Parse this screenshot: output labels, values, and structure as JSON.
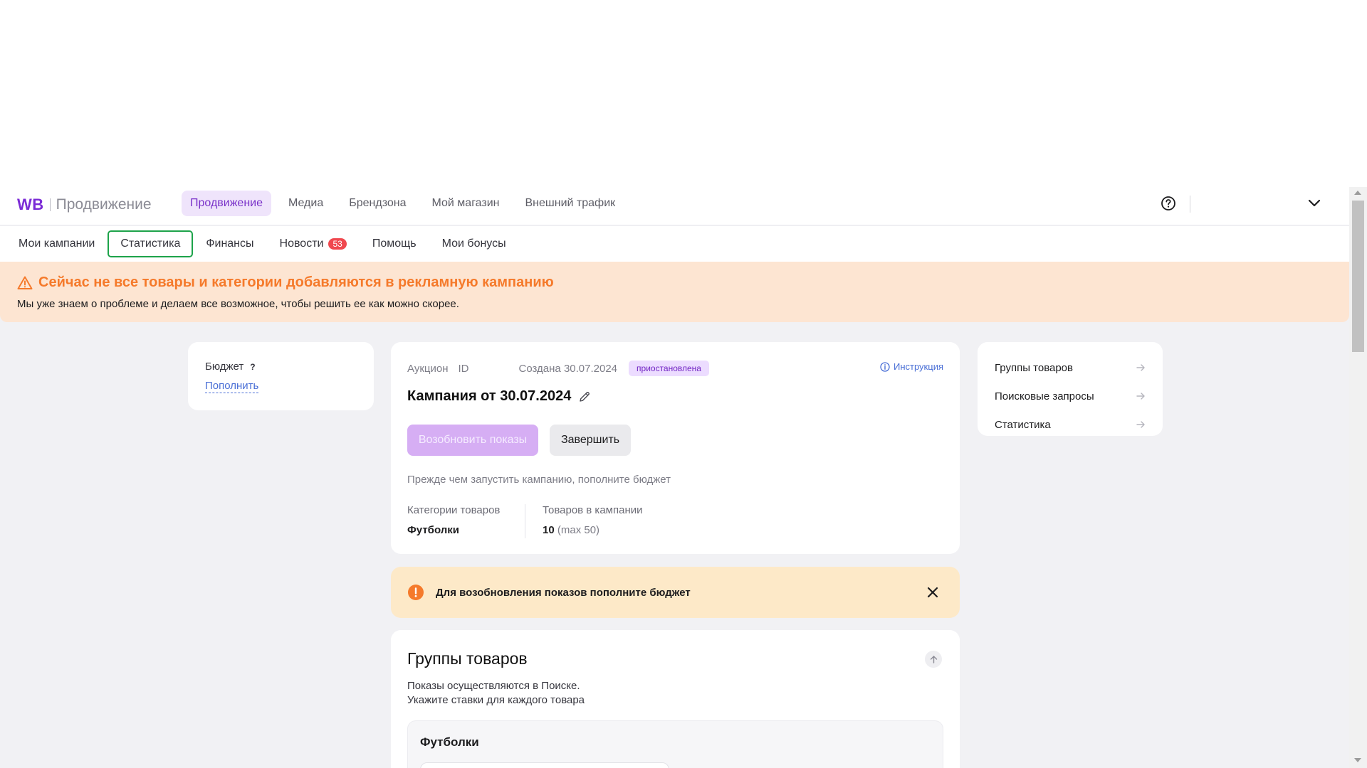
{
  "header": {
    "logo_brand": "WB",
    "logo_title": "Продвижение",
    "main_nav": [
      "Продвижение",
      "Медиа",
      "Брендзона",
      "Мой магазин",
      "Внешний трафик"
    ],
    "active_main_nav": "Продвижение"
  },
  "sub_nav": {
    "items": [
      "Мои кампании",
      "Статистика",
      "Финансы",
      "Новости",
      "Помощь",
      "Мои бонусы"
    ],
    "focused_item": "Статистика",
    "news_badge": "53"
  },
  "warning": {
    "title": "Сейчас не все товары и категории добавляются в рекламную кампанию",
    "text": "Мы уже знаем о проблеме и делаем все возможное, чтобы решить ее как можно скорее."
  },
  "budget": {
    "label": "Бюджет",
    "help": "?",
    "topup_link": "Пополнить"
  },
  "campaign": {
    "type": "Аукцион",
    "id_label": "ID",
    "created": "Создана 30.07.2024",
    "status": "приостановлена",
    "instruction": "Инструкция",
    "title": "Кампания от 30.07.2024",
    "resume_button": "Возобновить показы",
    "finish_button": "Завершить",
    "hint": "Прежде чем запустить кампанию, пополните бюджет",
    "category_label": "Категории товаров",
    "category_value": "Футболки",
    "products_label": "Товаров в кампании",
    "products_value": "10",
    "products_max": "(max 50)"
  },
  "side_links": [
    "Группы товаров",
    "Поисковые запросы",
    "Статистика"
  ],
  "alert": {
    "text": "Для возобновления показов пополните бюджет"
  },
  "groups": {
    "title": "Группы товаров",
    "desc_line1": "Показы осуществляются в Поиске.",
    "desc_line2": "Укажите ставки для каждого товара",
    "group_name": "Футболки"
  },
  "colors": {
    "brand_purple": "#7b2bd6",
    "warning_orange": "#f57a2b",
    "link_blue": "#4a6fd6",
    "focus_green": "#1da34a",
    "badge_red": "#f0484f"
  }
}
